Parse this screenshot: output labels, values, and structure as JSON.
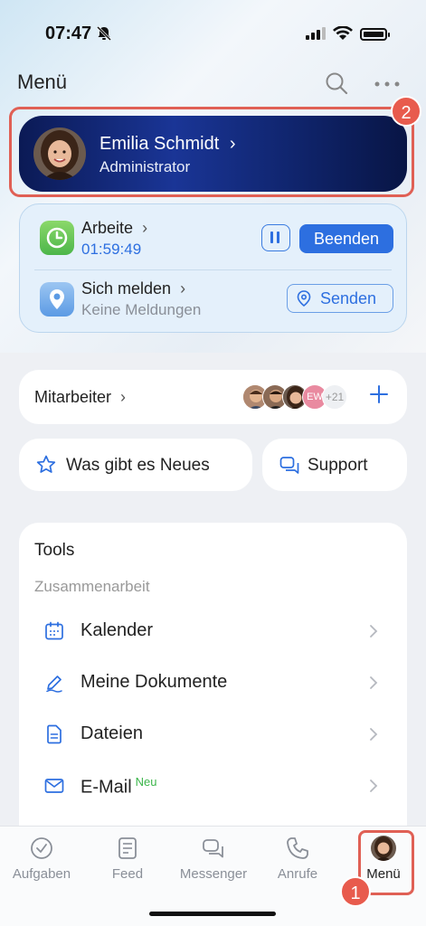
{
  "status_bar": {
    "time": "07:47"
  },
  "header": {
    "title": "Menü"
  },
  "profile": {
    "name": "Emilia Schmidt",
    "role": "Administrator"
  },
  "annotations": {
    "profile_badge": "2",
    "menu_badge": "1"
  },
  "work": {
    "title": "Arbeite",
    "timer": "01:59:49",
    "end_label": "Beenden",
    "report_title": "Sich melden",
    "report_status": "Keine Meldungen",
    "send_label": "Senden"
  },
  "employees": {
    "label": "Mitarbeiter",
    "initials": "EW",
    "more_count": "+21"
  },
  "quick": {
    "news_label": "Was gibt es Neues",
    "support_label": "Support"
  },
  "tools": {
    "title": "Tools",
    "section": "Zusammenarbeit",
    "items": [
      {
        "label": "Kalender",
        "icon": "calendar-icon"
      },
      {
        "label": "Meine Dokumente",
        "icon": "pen-icon"
      },
      {
        "label": "Dateien",
        "icon": "file-icon"
      },
      {
        "label": "E-Mail",
        "icon": "mail-icon",
        "tag": "Neu"
      }
    ]
  },
  "tabs": [
    {
      "label": "Aufgaben",
      "icon": "check-circle-icon"
    },
    {
      "label": "Feed",
      "icon": "feed-icon"
    },
    {
      "label": "Messenger",
      "icon": "chat-icon"
    },
    {
      "label": "Anrufe",
      "icon": "phone-icon"
    },
    {
      "label": "Menü",
      "icon": "avatar"
    }
  ],
  "colors": {
    "accent": "#2d6fe0",
    "profile_card": "#14297a",
    "highlight": "#e06055",
    "new_tag": "#3bb54a"
  }
}
